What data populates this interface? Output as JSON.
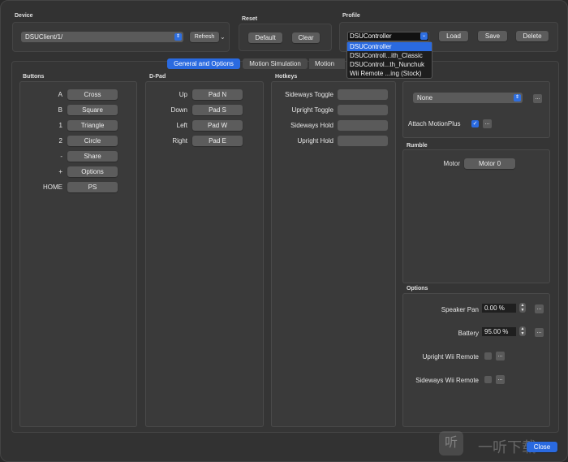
{
  "device": {
    "title": "Device",
    "selected": "DSUClient/1/",
    "refresh_label": "Refresh",
    "refresh_caret": "⌄"
  },
  "reset": {
    "title": "Reset",
    "default_label": "Default",
    "clear_label": "Clear"
  },
  "profile": {
    "title": "Profile",
    "selected": "DSUController",
    "load_label": "Load",
    "save_label": "Save",
    "delete_label": "Delete",
    "options": [
      "DSUController",
      "DSUControll...ith_Classic",
      "DSUControl...th_Nunchuk",
      "Wii Remote ...ing (Stock)"
    ]
  },
  "tabs": [
    "General and Options",
    "Motion Simulation",
    "Motion Inp"
  ],
  "buttons": {
    "title": "Buttons",
    "rows": [
      {
        "label": "A",
        "value": "Cross"
      },
      {
        "label": "B",
        "value": "Square"
      },
      {
        "label": "1",
        "value": "Triangle"
      },
      {
        "label": "2",
        "value": "Circle"
      },
      {
        "label": "-",
        "value": "Share"
      },
      {
        "label": "+",
        "value": "Options"
      },
      {
        "label": "HOME",
        "value": "PS"
      }
    ]
  },
  "dpad": {
    "title": "D-Pad",
    "rows": [
      {
        "label": "Up",
        "value": "Pad N"
      },
      {
        "label": "Down",
        "value": "Pad S"
      },
      {
        "label": "Left",
        "value": "Pad W"
      },
      {
        "label": "Right",
        "value": "Pad E"
      }
    ]
  },
  "hotkeys": {
    "title": "Hotkeys",
    "rows": [
      {
        "label": "Sideways Toggle",
        "value": ""
      },
      {
        "label": "Upright Toggle",
        "value": ""
      },
      {
        "label": "Sideways Hold",
        "value": ""
      },
      {
        "label": "Upright Hold",
        "value": ""
      }
    ]
  },
  "extension": {
    "selected": "None",
    "more": "...",
    "motionplus_label": "Attach MotionPlus",
    "motionplus_checked": true
  },
  "rumble": {
    "title": "Rumble",
    "motor_label": "Motor",
    "motor_value": "Motor 0"
  },
  "options": {
    "title": "Options",
    "speaker_pan_label": "Speaker Pan",
    "speaker_pan_value": "0.00 %",
    "battery_label": "Battery",
    "battery_value": "95.00 %",
    "upright_label": "Upright Wii Remote",
    "sideways_label": "Sideways Wii Remote",
    "more": "..."
  },
  "close_label": "Close",
  "watermark": "一听下载",
  "colors": {
    "accent": "#2a6ae0",
    "background": "#323232"
  }
}
